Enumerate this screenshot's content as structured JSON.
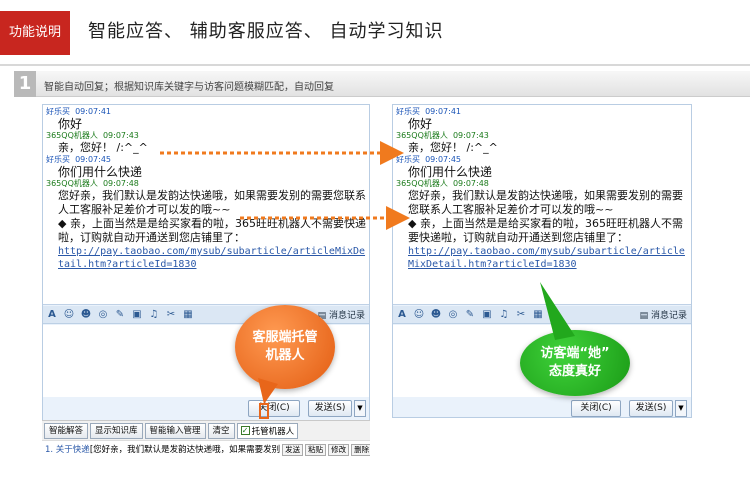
{
  "header": {
    "feature_tag": "功能说明",
    "title": "智能应答、 辅助客服应答、 自动学习知识"
  },
  "step": {
    "number": "1",
    "text": "智能自动回复；根据知识库关键字与访客问题模糊匹配，自动回复"
  },
  "left_chat": {
    "messages": [
      {
        "sender": "好乐买",
        "time": "09:07:41",
        "text": "你好",
        "color": "blue"
      },
      {
        "sender": "365QQ机器人",
        "time": "09:07:43",
        "text": "亲，您好！ /:^_^",
        "color": "green"
      },
      {
        "sender": "好乐买",
        "time": "09:07:45",
        "text": "你们用什么快递",
        "color": "blue"
      },
      {
        "sender": "365QQ机器人",
        "time": "09:07:48",
        "text": "您好亲，我们默认是发韵达快递哦，如果需要发别的需要您联系人工客服补足差价才可以发的哦~~",
        "color": "green"
      }
    ],
    "bullet": "◆ 亲，上面当然是是给买家看的啦，365旺旺机器人不需要快递啦，订购就自动开通送到您店铺里了：",
    "link": "http://pay.taobao.com/mysub/subarticle/articleMixDetail.htm?articleId=1830"
  },
  "right_chat": {
    "messages": [
      {
        "sender": "好乐买",
        "time": "09:07:41",
        "text": "你好",
        "color": "blue"
      },
      {
        "sender": "365QQ机器人",
        "time": "09:07:43",
        "text": "亲，您好！ /:^_^",
        "color": "green"
      },
      {
        "sender": "好乐买",
        "time": "09:07:45",
        "text": "你们用什么快递",
        "color": "blue"
      },
      {
        "sender": "365QQ机器人",
        "time": "09:07:48",
        "text": "您好亲，我们默认是发韵达快递哦，如果需要发别的需要您联系人工客服补足差价才可以发的哦~~",
        "color": "green"
      }
    ],
    "bullet": "◆ 亲，上面当然是是给买家看的啦，365旺旺机器人不需要快递啦，订购就自动开通送到您店铺里了：",
    "link": "http://pay.taobao.com/mysub/subarticle/articleMixDetail.htm?articleId=1830"
  },
  "toolbar": {
    "history_label": "消息记录",
    "icons": [
      "font-icon",
      "emoji-icon",
      "avatar-icon",
      "smile-icon",
      "edit-icon",
      "image-icon",
      "audio-icon",
      "scissors-icon",
      "calendar-icon"
    ]
  },
  "buttons": {
    "close": "关闭(C)",
    "send": "发送(S)"
  },
  "robot_bar": {
    "smart_answer": "智能解答",
    "show_kb": "显示知识库",
    "smart_input": "智能输入管理",
    "clear": "清空",
    "hosted": "托管机器人",
    "hosted_checked": "✓"
  },
  "quick": {
    "prefix": "1. 关于快递",
    "text": "[您好亲，我们默认是发韵达快递哦，如果需要发别",
    "send": "发送",
    "paste": "粘贴",
    "edit": "修改",
    "delete": "删除"
  },
  "bubbles": {
    "agent": "客服端托管机器人",
    "agent_line1": "客服端托管",
    "agent_line2": "机器人",
    "visitor_line1": "访客端“她”",
    "visitor_line2": "态度真好"
  },
  "colors": {
    "accent": "#c8261f",
    "arrow": "#f07a1e",
    "agent_bubble": "#e8661a",
    "visitor_bubble": "#22a81d"
  }
}
